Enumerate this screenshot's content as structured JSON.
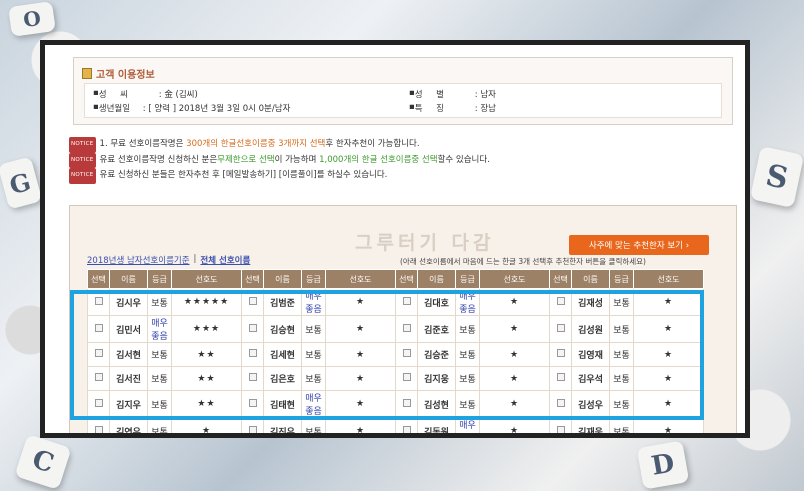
{
  "customer": {
    "title": "고객 이용정보",
    "surname_label": "성     씨",
    "surname_value": ": 金 (김씨)",
    "gender_label": "성     별",
    "gender_value": ": 남자",
    "birth_label": "생년월일",
    "birth_value": ": [ 양력 ] 2018년 3월 3일 0시 0분/남자",
    "feature_label": "특     징",
    "feature_value": ": 장남"
  },
  "notices": {
    "badge": "NOTICE",
    "line1_a": "1. 무료 선호이름작명은 ",
    "line1_b": "300개의 한글선호이름중 3개까지 선택",
    "line1_c": "후 한자추천이 가능합니다.",
    "line2_a": "유료 선호이름작명 신청하신 분은",
    "line2_b": "무제한으로 선택",
    "line2_c": "이 가능하며 ",
    "line2_d": "1,000개의 한글 선호이름중 선택",
    "line2_e": "할수 있습니다.",
    "line3": "유료 신청하신 분들은 한자추천 후 [메일발송하기] [이름풀이]를 하실수 있습니다."
  },
  "panel": {
    "watermark": "그루터기 다감",
    "recommend_button": "사주에 맞는 추천한자 보기  ›",
    "tab_2018": "2018년생 남자선호이름기준",
    "tab_sep": "|",
    "tab_all": "전체 선호이름",
    "hint": "(아래 선호이름에서 마음에 드는 한글 3개 선택후 추천한자 버튼을 클릭하세요)"
  },
  "table": {
    "headers": [
      "선택",
      "이름",
      "등급",
      "선호도"
    ],
    "rows": [
      [
        {
          "name": "김시우",
          "grade": "보통",
          "stars": "★★★★★"
        },
        {
          "name": "김범준",
          "grade": "매우좋음",
          "stars": "★"
        },
        {
          "name": "김대호",
          "grade": "매우좋음",
          "stars": "★"
        },
        {
          "name": "김재성",
          "grade": "보통",
          "stars": "★"
        }
      ],
      [
        {
          "name": "김민서",
          "grade": "매우좋음",
          "stars": "★★★"
        },
        {
          "name": "김승현",
          "grade": "보통",
          "stars": "★"
        },
        {
          "name": "김준호",
          "grade": "보통",
          "stars": "★"
        },
        {
          "name": "김성원",
          "grade": "보통",
          "stars": "★"
        }
      ],
      [
        {
          "name": "김서현",
          "grade": "보통",
          "stars": "★★"
        },
        {
          "name": "김세현",
          "grade": "보통",
          "stars": "★"
        },
        {
          "name": "김승준",
          "grade": "보통",
          "stars": "★"
        },
        {
          "name": "김영재",
          "grade": "보통",
          "stars": "★"
        }
      ],
      [
        {
          "name": "김서진",
          "grade": "보통",
          "stars": "★★"
        },
        {
          "name": "김은호",
          "grade": "보통",
          "stars": "★"
        },
        {
          "name": "김지웅",
          "grade": "보통",
          "stars": "★"
        },
        {
          "name": "김우석",
          "grade": "보통",
          "stars": "★"
        }
      ],
      [
        {
          "name": "김지우",
          "grade": "보통",
          "stars": "★★"
        },
        {
          "name": "김태현",
          "grade": "매우좋음",
          "stars": "★"
        },
        {
          "name": "김성현",
          "grade": "보통",
          "stars": "★"
        },
        {
          "name": "김성우",
          "grade": "보통",
          "stars": "★"
        }
      ],
      [
        {
          "name": "김연우",
          "grade": "보통",
          "stars": "★"
        },
        {
          "name": "김진우",
          "grade": "보통",
          "stars": "★"
        },
        {
          "name": "김동원",
          "grade": "매우좋음",
          "stars": "★"
        },
        {
          "name": "김재욱",
          "grade": "보통",
          "stars": "★"
        }
      ]
    ]
  },
  "colors": {
    "highlight": "#1ea3e0",
    "header_bg": "#9d8166",
    "button_bg": "#e8671d",
    "star": "#d6a020"
  },
  "background_tiles": [
    "O",
    "S",
    "G",
    "C",
    "D"
  ]
}
